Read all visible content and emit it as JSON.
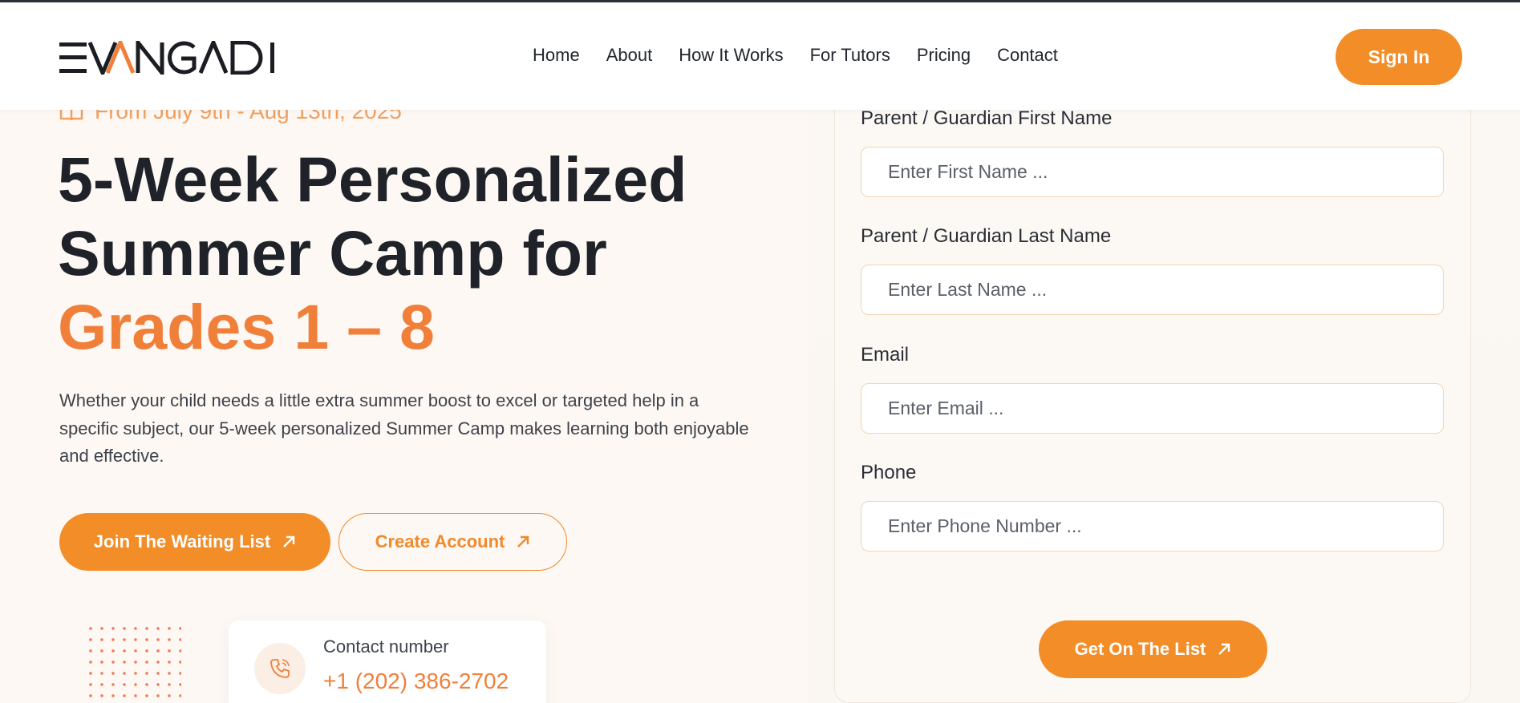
{
  "header": {
    "logo_text": "EVANGADI",
    "nav": [
      "Home",
      "About",
      "How It Works",
      "For Tutors",
      "Pricing",
      "Contact"
    ],
    "sign_in": "Sign In"
  },
  "hero": {
    "dates": "From July 9th - Aug 13th, 2025",
    "title_line1": "5-Week Personalized",
    "title_line2": "Summer Camp for",
    "title_accent": "Grades 1 – 8",
    "description": "Whether your child needs a little extra summer boost to excel or targeted help in a specific subject, our 5-week personalized Summer Camp makes learning both enjoyable and effective.",
    "primary_button": "Join The Waiting List",
    "secondary_button": "Create Account"
  },
  "contact": {
    "label": "Contact number",
    "number": "+1 (202) 386-2702"
  },
  "form": {
    "first_name_label": "Parent / Guardian First Name",
    "first_name_placeholder": "Enter First Name ...",
    "last_name_label": "Parent / Guardian Last Name",
    "last_name_placeholder": "Enter Last Name ...",
    "email_label": "Email",
    "email_placeholder": "Enter Email ...",
    "phone_label": "Phone",
    "phone_placeholder": "Enter Phone Number ...",
    "submit": "Get On The List"
  },
  "colors": {
    "accent": "#f28d28",
    "accent_text": "#f07f3a",
    "dark_text": "#1f2329"
  }
}
